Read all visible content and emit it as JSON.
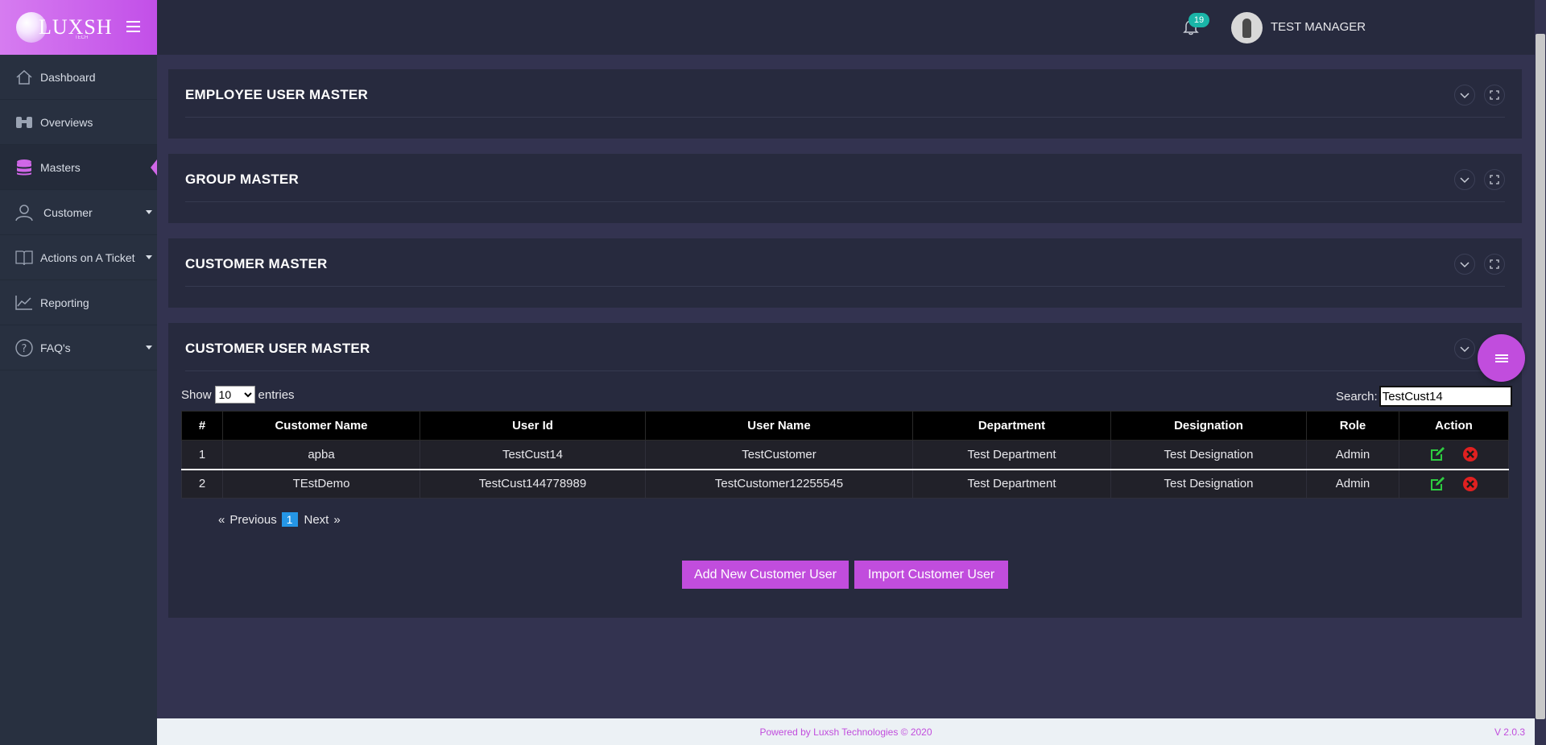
{
  "brand": {
    "name": "LUXSH",
    "sub": "TECH"
  },
  "sidebar": {
    "items": [
      {
        "label": "Dashboard",
        "icon": "home-icon"
      },
      {
        "label": "Overviews",
        "icon": "binoculars-icon"
      },
      {
        "label": "Masters",
        "icon": "database-icon"
      },
      {
        "label": "Customer",
        "icon": "user-icon"
      },
      {
        "label": "Actions on A Ticket",
        "icon": "book-icon"
      },
      {
        "label": "Reporting",
        "icon": "chart-line-icon"
      },
      {
        "label": "FAQ's",
        "icon": "question-circle-icon"
      }
    ]
  },
  "topbar": {
    "notification_count": "19",
    "user_name": "TEST MANAGER"
  },
  "panels": [
    {
      "title": "EMPLOYEE USER MASTER"
    },
    {
      "title": "GROUP MASTER"
    },
    {
      "title": "CUSTOMER MASTER"
    },
    {
      "title": "CUSTOMER USER MASTER"
    }
  ],
  "table_controls": {
    "show_label": "Show",
    "entries_label": "entries",
    "page_size": "10",
    "search_label": "Search:",
    "search_value": "TestCust14"
  },
  "table": {
    "headers": [
      "#",
      "Customer Name",
      "User Id",
      "User Name",
      "Department",
      "Designation",
      "Role",
      "Action"
    ],
    "rows": [
      [
        "1",
        "apba",
        "TestCust14",
        "TestCustomer",
        "Test Department",
        "Test Designation",
        "Admin"
      ],
      [
        "2",
        "TEstDemo",
        "TestCust144778989",
        "TestCustomer12255545",
        "Test Department",
        "Test Designation",
        "Admin"
      ]
    ]
  },
  "pagination": {
    "prev_arrow": "«",
    "previous": "Previous",
    "current": "1",
    "next": "Next",
    "next_arrow": "»"
  },
  "buttons": {
    "add": "Add New Customer User",
    "import": "Import Customer User"
  },
  "footer": {
    "text": "Powered by Luxsh Technologies © 2020",
    "version": "V 2.0.3"
  },
  "colors": {
    "accent": "#c14ddd",
    "badge": "#1ab5a8",
    "edit": "#2ecc40",
    "delete": "#e02020"
  }
}
